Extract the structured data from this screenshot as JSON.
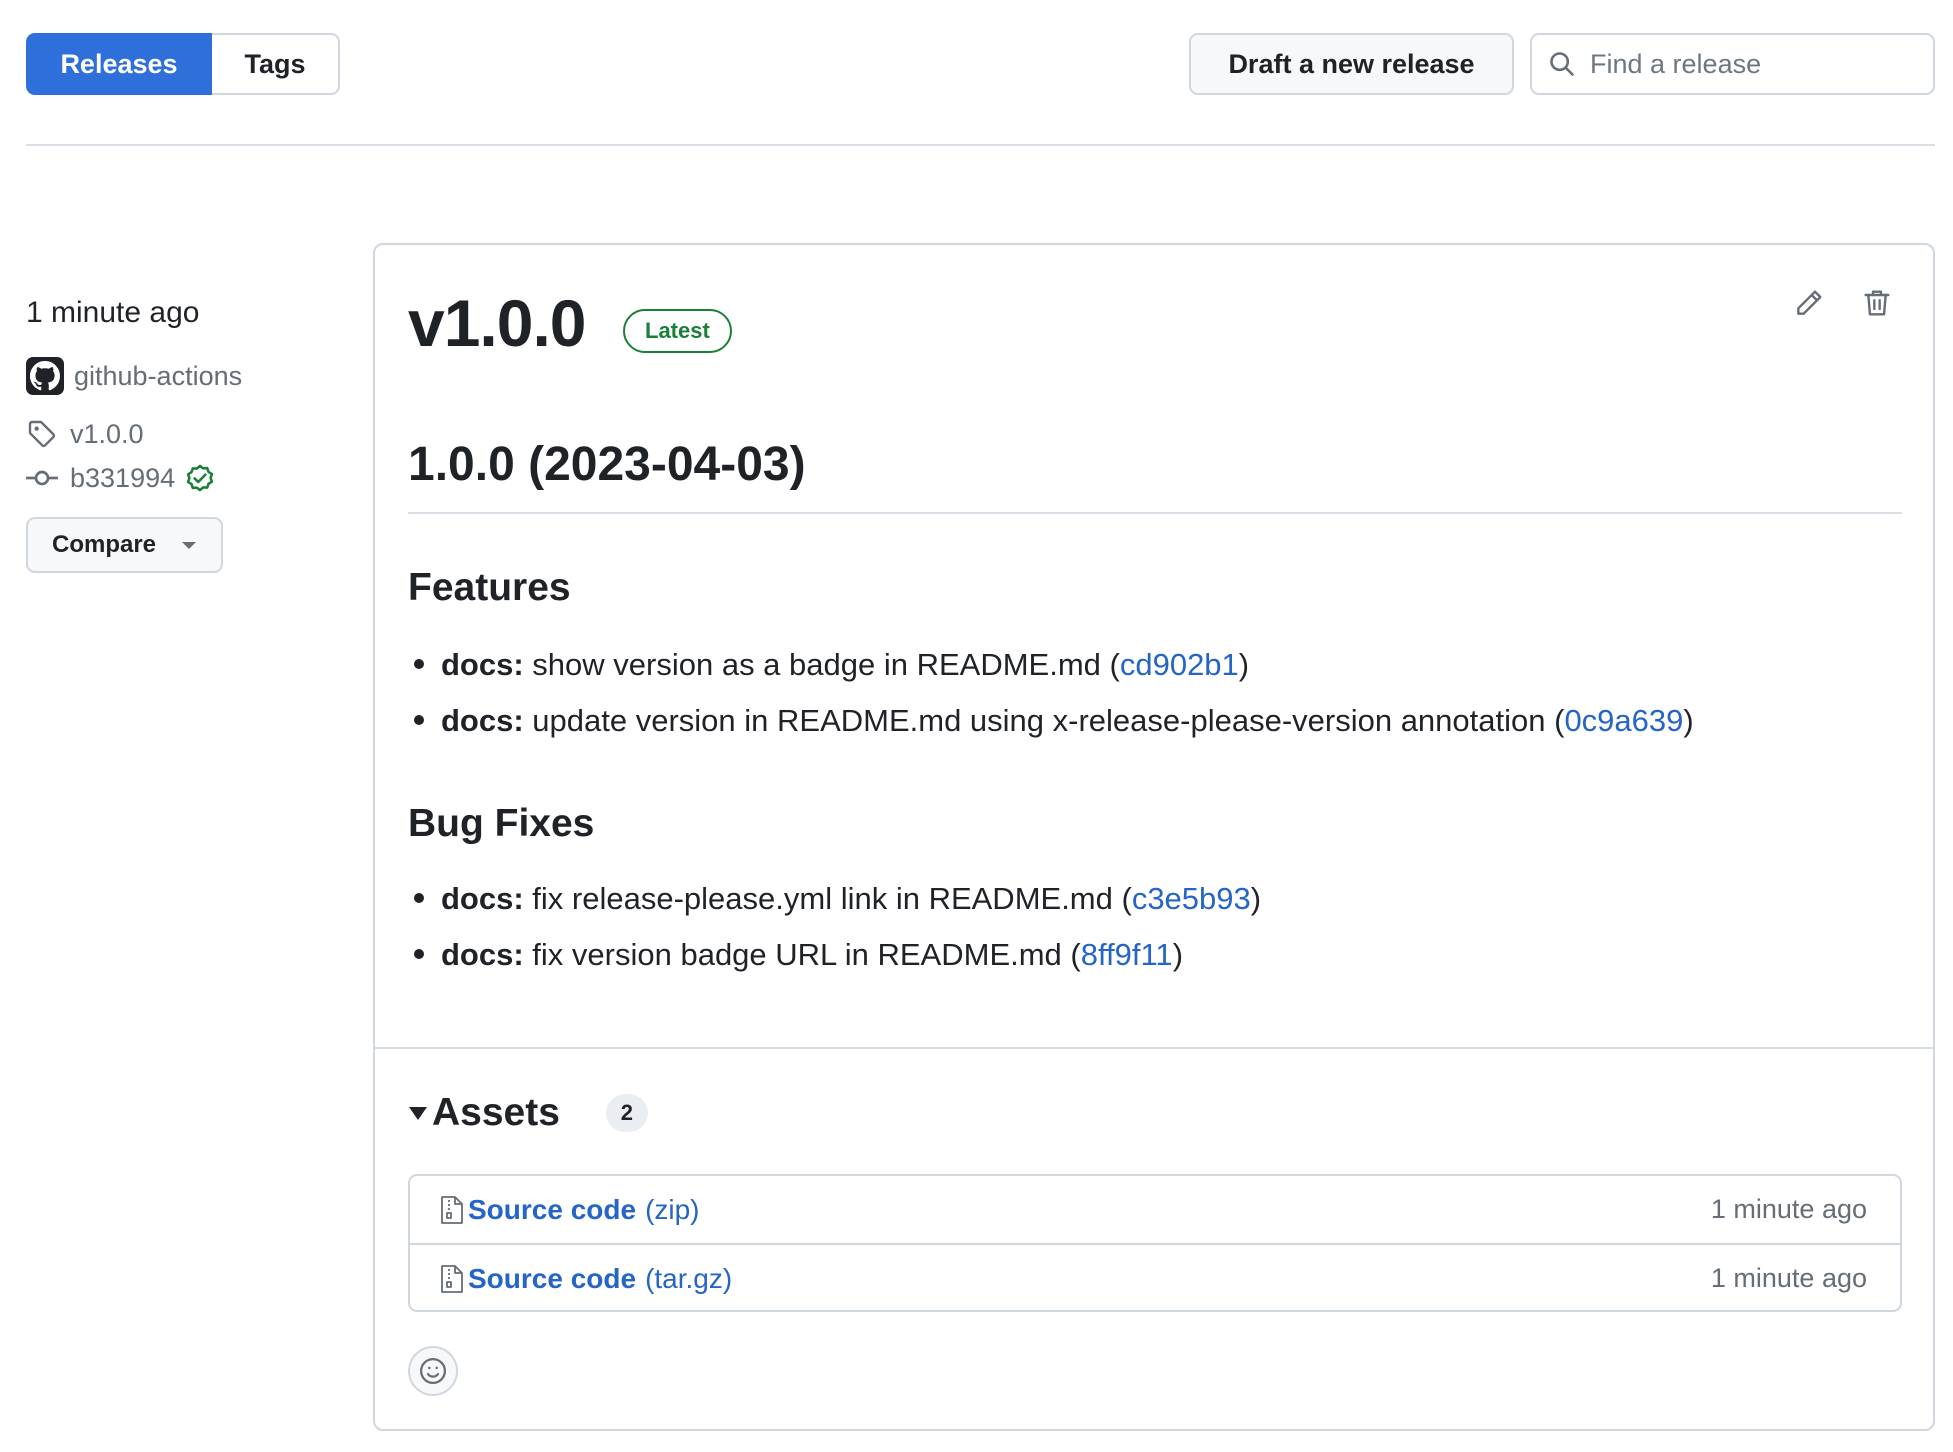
{
  "tabs": {
    "releases": "Releases",
    "tags": "Tags"
  },
  "toolbar": {
    "draft_label": "Draft a new release",
    "search_placeholder": "Find a release"
  },
  "sidebar": {
    "time": "1 minute ago",
    "author": "github-actions",
    "tag": "v1.0.0",
    "commit": "b331994",
    "compare_label": "Compare"
  },
  "release": {
    "title": "v1.0.0",
    "badge": "Latest",
    "heading": "1.0.0 (2023-04-03)",
    "sections": [
      {
        "title": "Features",
        "items": [
          {
            "scope": "docs:",
            "text": " show version as a badge in README.md (",
            "hash": "cd902b1",
            "close": ")"
          },
          {
            "scope": "docs:",
            "text": " update version in README.md using x-release-please-version annotation (",
            "hash": "0c9a639",
            "close": ")"
          }
        ]
      },
      {
        "title": "Bug Fixes",
        "items": [
          {
            "scope": "docs:",
            "text": " fix release-please.yml link in README.md (",
            "hash": "c3e5b93",
            "close": ")"
          },
          {
            "scope": "docs:",
            "text": " fix version badge URL in README.md (",
            "hash": "8ff9f11",
            "close": ")"
          }
        ]
      }
    ]
  },
  "assets": {
    "label": "Assets",
    "count": "2",
    "items": [
      {
        "name": "Source code",
        "ext": "(zip)",
        "time": "1 minute ago"
      },
      {
        "name": "Source code",
        "ext": "(tar.gz)",
        "time": "1 minute ago"
      }
    ]
  },
  "colors": {
    "accent": "#2f6fd9",
    "link": "#2565c7",
    "success": "#1a7f37",
    "border": "#d0d7de"
  },
  "icons": [
    "search-icon",
    "github-mark-icon",
    "tag-icon",
    "commit-icon",
    "verified-icon",
    "caret-down-icon",
    "pencil-icon",
    "trash-icon",
    "triangle-down-icon",
    "file-zip-icon",
    "smiley-icon"
  ]
}
